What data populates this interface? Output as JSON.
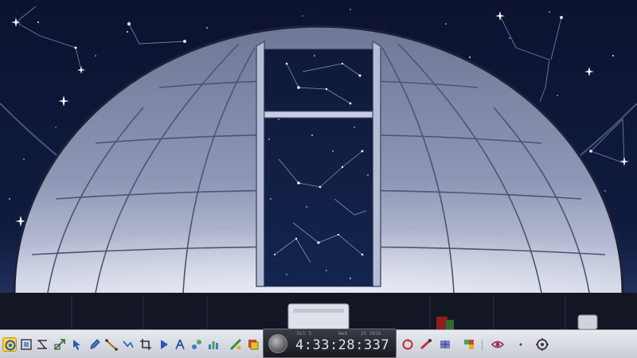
{
  "time": {
    "weekday_label": "Wed",
    "date_label": "Oct 5",
    "year_label": "25 2016",
    "clock": "4:33:28:337"
  },
  "colors": {
    "sky": "#0a0f24",
    "dome": "#a3aac4",
    "toolbar": "#d9dce4",
    "accent": "#ffd34d"
  },
  "toolbar": {
    "left_tools": [
      "atlas-icon",
      "frame-icon",
      "measure-icon",
      "zoom-region-icon",
      "select-icon",
      "pencil-icon",
      "line-icon",
      "path-icon",
      "crop-icon",
      "play-icon",
      "text-icon",
      "labels-icon",
      "chart-icon",
      "ruler-icon",
      "layers-icon"
    ],
    "right_tools": [
      "refresh-icon",
      "telescope-icon",
      "grid-icon",
      "puzzle-icon",
      "eye-icon",
      "dot-icon",
      "settings-icon"
    ]
  }
}
